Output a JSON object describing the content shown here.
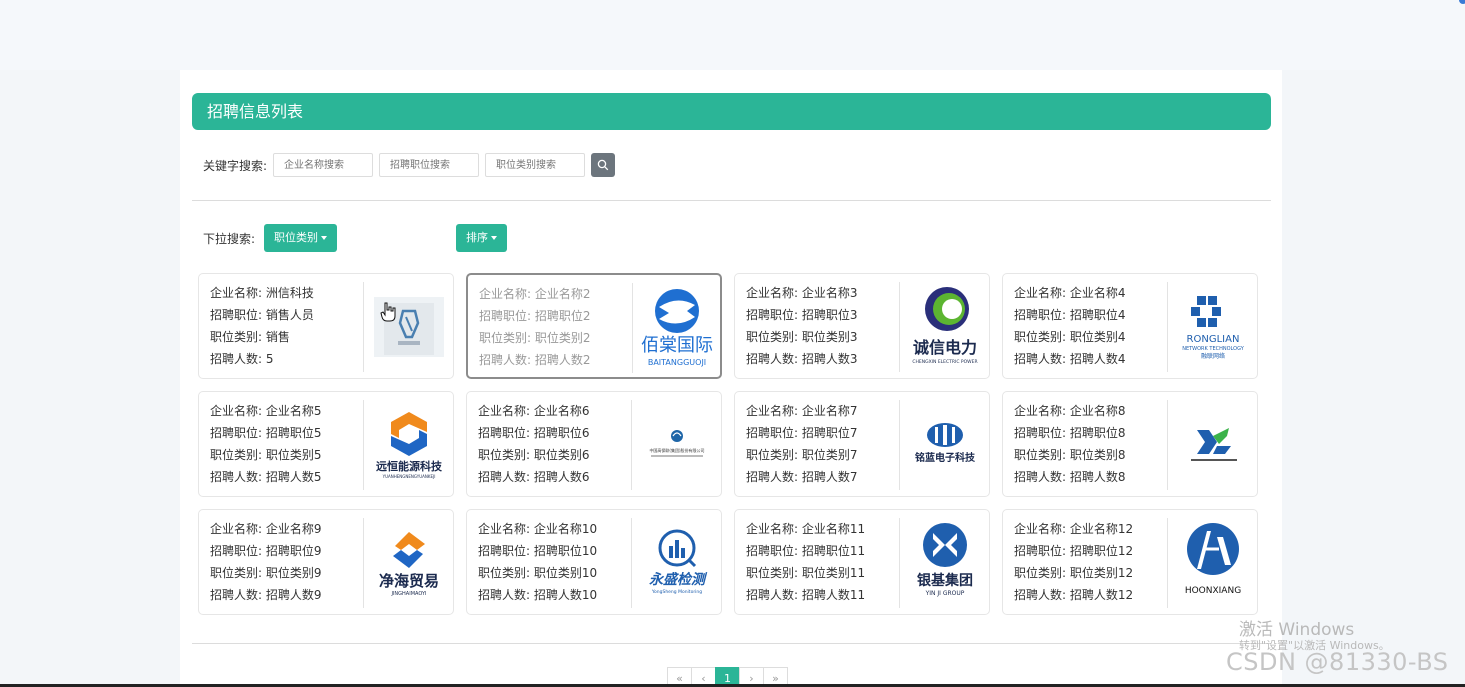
{
  "header": {
    "title": "招聘信息列表"
  },
  "search": {
    "label": "关键字搜索:",
    "company_placeholder": "企业名称搜索",
    "position_placeholder": "招聘职位搜索",
    "category_placeholder": "职位类别搜索",
    "button_icon": "search-icon"
  },
  "dropdown": {
    "label": "下拉搜索:",
    "category_button": "职位类别",
    "sort_button": "排序"
  },
  "cards": [
    {
      "company": "企业名称: 洲信科技",
      "position": "招聘职位: 销售人员",
      "category": "职位类别: 销售",
      "count": "招聘人数: 5",
      "logo": "zhouxin-logo"
    },
    {
      "company": "企业名称: 企业名称2",
      "position": "招聘职位: 招聘职位2",
      "category": "职位类别: 职位类别2",
      "count": "招聘人数: 招聘人数2",
      "logo": "baitangguoji-logo",
      "logo_text": "佰棠国际",
      "logo_sub": "BAITANGGUOJI"
    },
    {
      "company": "企业名称: 企业名称3",
      "position": "招聘职位: 招聘职位3",
      "category": "职位类别: 职位类别3",
      "count": "招聘人数: 招聘人数3",
      "logo": "chengxin-logo",
      "logo_text": "诚信电力",
      "logo_sub": "CHENGXIN ELECTRIC POWER"
    },
    {
      "company": "企业名称: 企业名称4",
      "position": "招聘职位: 招聘职位4",
      "category": "职位类别: 职位类别4",
      "count": "招聘人数: 招聘人数4",
      "logo": "ronglian-logo",
      "logo_text": "RONGLIAN",
      "logo_sub": "NETWORK TECHNOLOGY",
      "logo_sub2": "融联网络"
    },
    {
      "company": "企业名称: 企业名称5",
      "position": "招聘职位: 招聘职位5",
      "category": "职位类别: 职位类别5",
      "count": "招聘人数: 招聘人数5",
      "logo": "yuanheng-logo",
      "logo_text": "远恒能源科技",
      "logo_sub": "YUANHENGNENGYUANKEJI"
    },
    {
      "company": "企业名称: 企业名称6",
      "position": "招聘职位: 招聘职位6",
      "category": "职位类别: 职位类别6",
      "count": "招聘人数: 招聘人数6",
      "logo": "corporation-logo",
      "logo_text": "中国高保联(集团)股份有限公司"
    },
    {
      "company": "企业名称: 企业名称7",
      "position": "招聘职位: 招聘职位7",
      "category": "职位类别: 职位类别7",
      "count": "招聘人数: 招聘人数7",
      "logo": "weilan-logo",
      "logo_text": "铭蓝电子科技"
    },
    {
      "company": "企业名称: 企业名称8",
      "position": "招聘职位: 招聘职位8",
      "category": "职位类别: 职位类别8",
      "count": "招聘人数: 招聘人数8",
      "logo": "xs-logo"
    },
    {
      "company": "企业名称: 企业名称9",
      "position": "招聘职位: 招聘职位9",
      "category": "职位类别: 职位类别9",
      "count": "招聘人数: 招聘人数9",
      "logo": "jinghai-logo",
      "logo_text": "净海贸易",
      "logo_sub": "JINGHAIMAOYI"
    },
    {
      "company": "企业名称: 企业名称10",
      "position": "招聘职位: 招聘职位10",
      "category": "职位类别: 职位类别10",
      "count": "招聘人数: 招聘人数10",
      "logo": "yongsheng-logo",
      "logo_text": "永盛检测",
      "logo_sub": "YongSheng Monitoring"
    },
    {
      "company": "企业名称: 企业名称11",
      "position": "招聘职位: 招聘职位11",
      "category": "职位类别: 职位类别11",
      "count": "招聘人数: 招聘人数11",
      "logo": "yinji-logo",
      "logo_text": "银基集团",
      "logo_sub": "YIN JI GROUP"
    },
    {
      "company": "企业名称: 企业名称12",
      "position": "招聘职位: 招聘职位12",
      "category": "职位类别: 职位类别12",
      "count": "招聘人数: 招聘人数12",
      "logo": "hoonxiang-logo",
      "logo_text": "HOONXIANG"
    }
  ],
  "pagination": {
    "first": "«",
    "prev": "‹",
    "current": "1",
    "next": "›",
    "last": "»"
  },
  "watermark": {
    "line1": "激活 Windows",
    "line2": "转到\"设置\"以激活 Windows。",
    "csdn": "CSDN @81330-BS"
  },
  "colors": {
    "accent": "#2bb597",
    "search_button": "#6c757d"
  }
}
